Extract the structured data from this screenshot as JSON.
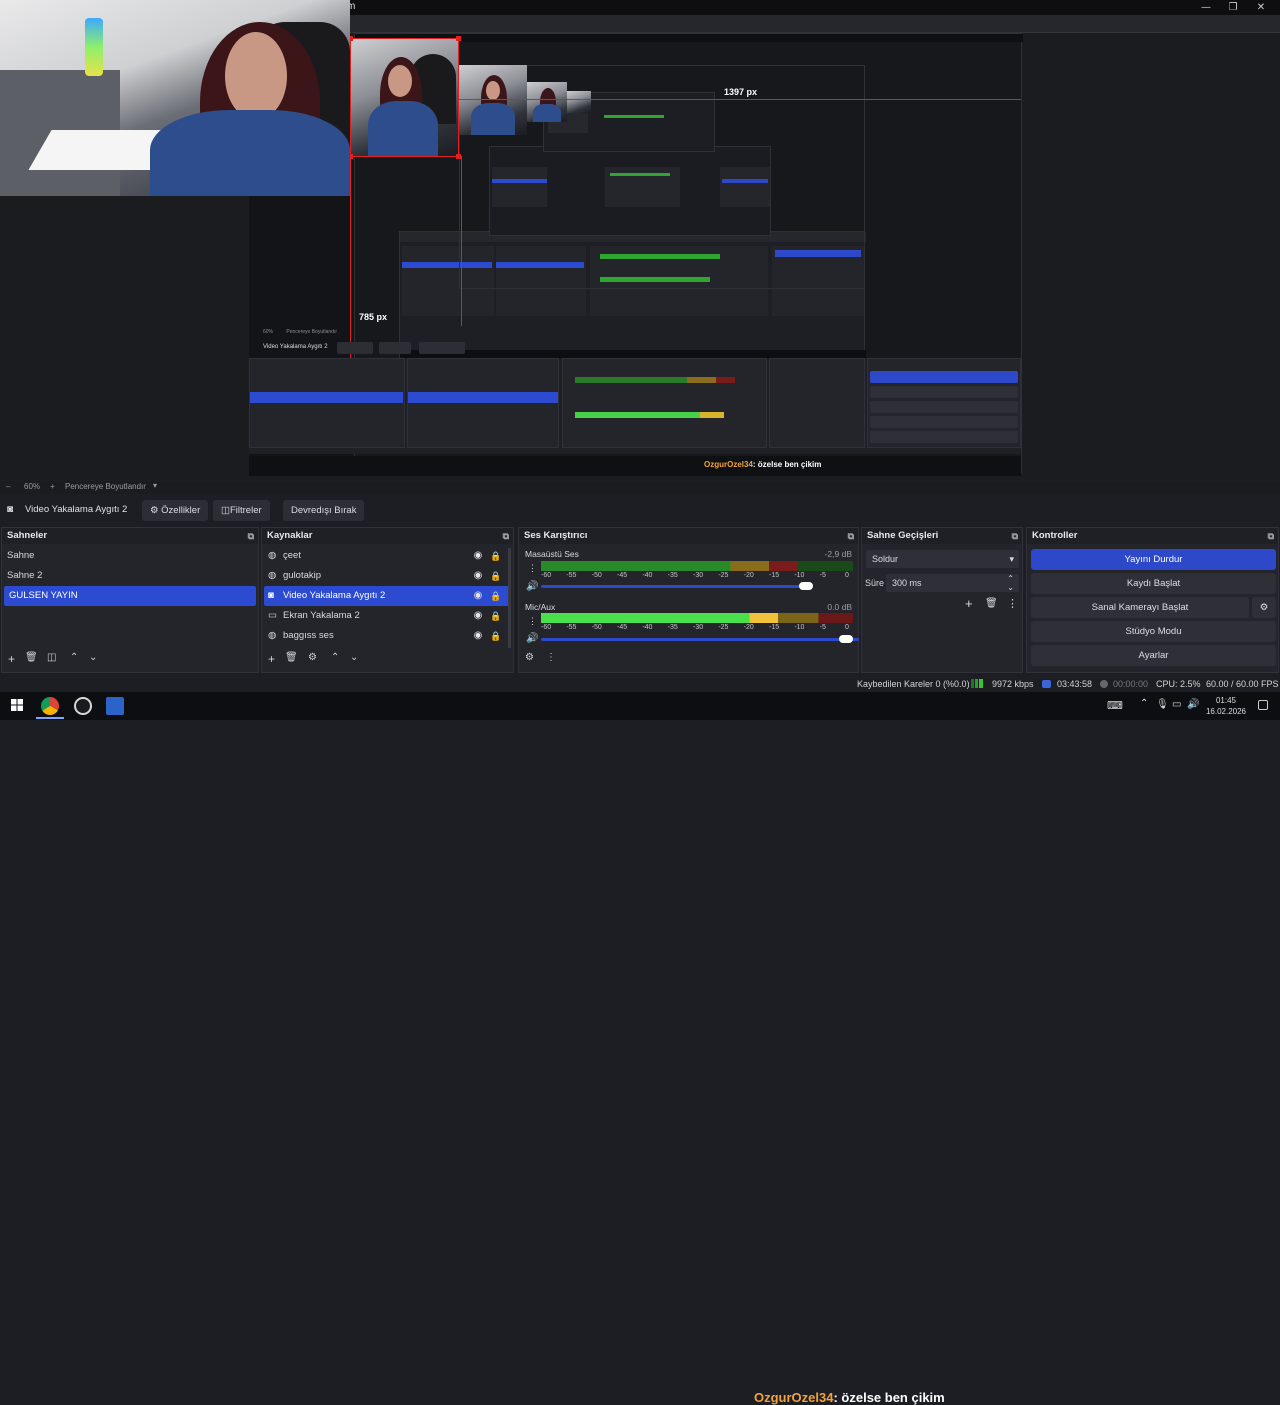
{
  "window": {
    "title_fragment": "m",
    "minimize": "—",
    "maximize": "❐",
    "close": "✕"
  },
  "preview": {
    "label_width": "1397 px",
    "label_height": "785 px",
    "nested_source_label": "Video Yakalama Aygıtı 2",
    "nested_zoom": "60%",
    "nested_fit": "Pencereye Boyutlandır"
  },
  "zoombar": {
    "zoom": "60%",
    "fit_label": "Pencereye Boyutlandır"
  },
  "toolbar": {
    "source_name": "Video Yakalama Aygıtı 2",
    "properties": "Özellikler",
    "filters": "Filtreler",
    "deactivate": "Devredışı Bırak"
  },
  "scenes": {
    "title": "Sahneler",
    "items": [
      "Sahne",
      "Sahne 2",
      "GULSEN YAYIN"
    ],
    "selected": "GULSEN YAYIN"
  },
  "sources": {
    "title": "Kaynaklar",
    "items": [
      {
        "name": "çeet",
        "icon": "globe-icon"
      },
      {
        "name": "gulotakip",
        "icon": "globe-icon"
      },
      {
        "name": "Video Yakalama Aygıtı 2",
        "icon": "camera-icon"
      },
      {
        "name": "Ekran Yakalama 2",
        "icon": "monitor-icon"
      },
      {
        "name": "baggıss ses",
        "icon": "globe-icon"
      }
    ],
    "selected": "Video Yakalama Aygıtı 2"
  },
  "mixer": {
    "title": "Ses Karıştırıcı",
    "channels": [
      {
        "name": "Masaüstü Ses",
        "db": "-2,9 dB",
        "level": 0.82
      },
      {
        "name": "Mic/Aux",
        "db": "0.0 dB",
        "level": 0.76
      }
    ],
    "scale": [
      "-60",
      "-55",
      "-50",
      "-45",
      "-40",
      "-35",
      "-30",
      "-25",
      "-20",
      "-15",
      "-10",
      "-5",
      "0"
    ]
  },
  "transitions": {
    "title": "Sahne Geçişleri",
    "selected": "Soldur",
    "duration_label": "Süre",
    "duration_value": "300 ms"
  },
  "controls": {
    "title": "Kontroller",
    "stop_stream": "Yayını Durdur",
    "start_record": "Kaydı Başlat",
    "virtual_cam": "Sanal Kamerayı Başlat",
    "studio_mode": "Stüdyo Modu",
    "settings": "Ayarlar"
  },
  "status": {
    "dropped": "Kaybedilen Kareler 0 (%0.0)",
    "bitrate": "9972 kbps",
    "stream_time": "03:43:58",
    "rec_time": "00:00:00",
    "cpu": "CPU: 2.5%",
    "fps": "60.00 / 60.00 FPS"
  },
  "overlay": {
    "username": "OzgurOzel34",
    "message": ": özelse ben çikim"
  },
  "taskbar": {
    "time": "01:45",
    "date": "16.02.2026"
  },
  "colors": {
    "accent": "#2c4bd0",
    "bounding_box": "#e02121",
    "meter_green": "#2fa62f",
    "meter_yellow": "#c9a227",
    "meter_red": "#b02525"
  }
}
